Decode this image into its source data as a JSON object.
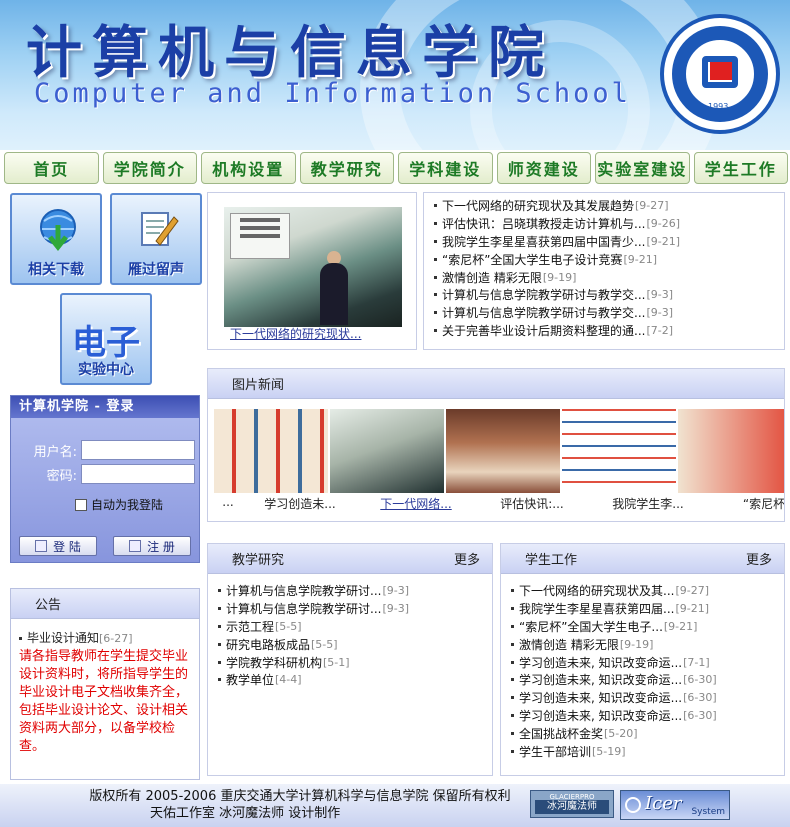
{
  "header": {
    "title": "计算机与信息学院",
    "subtitle": "Computer and Information School",
    "logo_text": "Computer and Information School",
    "logo_year": "1993"
  },
  "nav": [
    {
      "label": "首页"
    },
    {
      "label": "学院简介"
    },
    {
      "label": "机构设置"
    },
    {
      "label": "教学研究"
    },
    {
      "label": "学科建设"
    },
    {
      "label": "师资建设"
    },
    {
      "label": "实验室建设"
    },
    {
      "label": "学生工作"
    }
  ],
  "quick_links": {
    "download": "相关下载",
    "guestbook": "雁过留声",
    "lab_big": "电子",
    "lab_sub": "实验中心"
  },
  "login": {
    "title": "计算机学院 - 登录",
    "username_label": "用户名:",
    "password_label": "密码:",
    "auto_login": "自动为我登陆",
    "login_button": "登 陆",
    "register_button": "注 册"
  },
  "notice": {
    "title": "公告",
    "item": "毕业设计通知",
    "date": "[6-27]",
    "body": "请各指导教师在学生提交毕业设计资料时，将所指导学生的毕业设计电子文档收集齐全，包括毕业设计论文、设计相关资料两大部分，以备学校检查。"
  },
  "photo": {
    "caption": "下一代网络的研究现状..."
  },
  "top_news": [
    {
      "title": "下一代网络的研究现状及其发展趋势",
      "date": "[9-27]"
    },
    {
      "title": "评估快讯：吕晓琪教授走访计算机与...",
      "date": "[9-26]"
    },
    {
      "title": "我院学生李星星喜获第四届中国青少...",
      "date": "[9-21]"
    },
    {
      "title": "“索尼杯”全国大学生电子设计竞赛",
      "date": "[9-21]"
    },
    {
      "title": "激情创造 精彩无限",
      "date": "[9-19]"
    },
    {
      "title": "计算机与信息学院教学研讨与教学交...",
      "date": "[9-3]"
    },
    {
      "title": "计算机与信息学院教学研讨与教学交...",
      "date": "[9-3]"
    },
    {
      "title": "关于完善毕业设计后期资料整理的通...",
      "date": "[7-2]"
    }
  ],
  "picture_news": {
    "title": "图片新闻",
    "captions": [
      "...",
      "学习创造未...",
      "下一代网络...",
      "评估快讯:...",
      "我院学生李...",
      "“索尼杯"
    ]
  },
  "teaching": {
    "title": "教学研究",
    "more": "更多",
    "items": [
      {
        "title": "计算机与信息学院教学研讨...",
        "date": "[9-3]"
      },
      {
        "title": "计算机与信息学院教学研讨...",
        "date": "[9-3]"
      },
      {
        "title": "示范工程",
        "date": "[5-5]"
      },
      {
        "title": "研究电路板成品",
        "date": "[5-5]"
      },
      {
        "title": "学院教学科研机构",
        "date": "[5-1]"
      },
      {
        "title": "教学单位",
        "date": "[4-4]"
      }
    ]
  },
  "student_work": {
    "title": "学生工作",
    "more": "更多",
    "items": [
      {
        "title": "下一代网络的研究现状及其...",
        "date": "[9-27]"
      },
      {
        "title": "我院学生李星星喜获第四届...",
        "date": "[9-21]"
      },
      {
        "title": "“索尼杯”全国大学生电子...",
        "date": "[9-21]"
      },
      {
        "title": "激情创造 精彩无限",
        "date": "[9-19]"
      },
      {
        "title": "学习创造未来, 知识改变命运...",
        "date": "[7-1]"
      },
      {
        "title": "学习创造未来, 知识改变命运...",
        "date": "[6-30]"
      },
      {
        "title": "学习创造未来, 知识改变命运...",
        "date": "[6-30]"
      },
      {
        "title": "学习创造未来, 知识改变命运...",
        "date": "[6-30]"
      },
      {
        "title": "全国挑战杯金奖",
        "date": "[5-20]"
      },
      {
        "title": "学生干部培训",
        "date": "[5-19]"
      }
    ]
  },
  "footer": {
    "line1": "版权所有 2005-2006 重庆交通大学计算机科学与信息学院 保留所有权利",
    "line2": "天佑工作室 冰河魔法师 设计制作",
    "badge1_top": "GLACIERPRO",
    "badge1_main": "冰河魔法师",
    "badge2_main": "Icer",
    "badge2_sub": "System"
  }
}
